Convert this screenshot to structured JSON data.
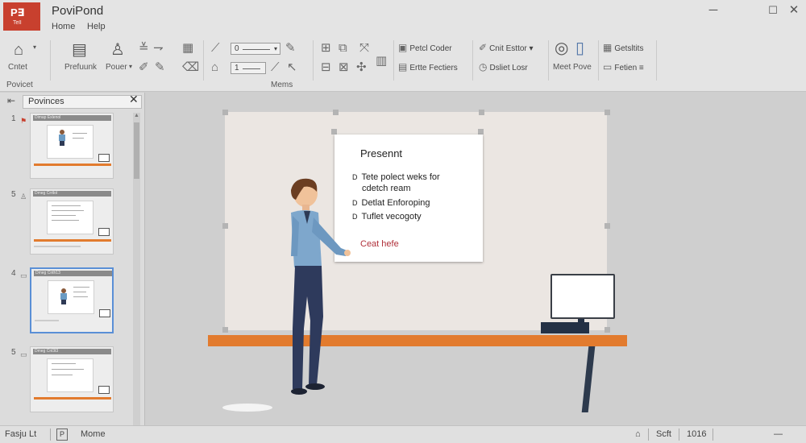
{
  "app": {
    "logo_big": "P∃",
    "logo_small": "Tell",
    "title": "PoviPond",
    "window_min": "─",
    "window_max": "☐",
    "window_close": "✕"
  },
  "menu": {
    "tabs": [
      "Home",
      "Help"
    ]
  },
  "ribbon": {
    "group_left_label": "Povicet",
    "group_mid_label": "Mems",
    "create_label": "Cntet",
    "paste_label": "Prefuunk",
    "power_label": "Pouer",
    "field1_value": "0",
    "field2_value": "1",
    "btn_labels": [
      "Petcl Coder",
      "Ertte Fectiers",
      "Cnit Esttor",
      "Dsliet Losr",
      "Meet Pove",
      "Getsltits",
      "Fetien"
    ],
    "icons": [
      "home-icon",
      "clipboard-icon",
      "user-icon",
      "align-icon",
      "slideshow-icon",
      "settings-icon"
    ]
  },
  "pane": {
    "title": "Povinces",
    "close": "✕",
    "back": "⇤",
    "slides": [
      {
        "num": "1",
        "title": "Dimap Exlenol"
      },
      {
        "num": "5",
        "title": "Dmeg Crrtlol"
      },
      {
        "num": "4",
        "title": "Dmeg Cnth13"
      },
      {
        "num": "5",
        "title": "Dmeg Cnl3t3"
      }
    ]
  },
  "slide": {
    "card_title": "Presennt",
    "items": [
      "Tete polect weks for",
      "cdetch ream",
      "Detlat Enforoping",
      "Tuflet vecogoty"
    ],
    "bullet": "D",
    "cta": "Ceat hefe"
  },
  "status": {
    "left": "Fasju Lt",
    "icon": "P",
    "mode": "Mome",
    "view1": "Scft",
    "zoom": "1016",
    "end": "—"
  }
}
